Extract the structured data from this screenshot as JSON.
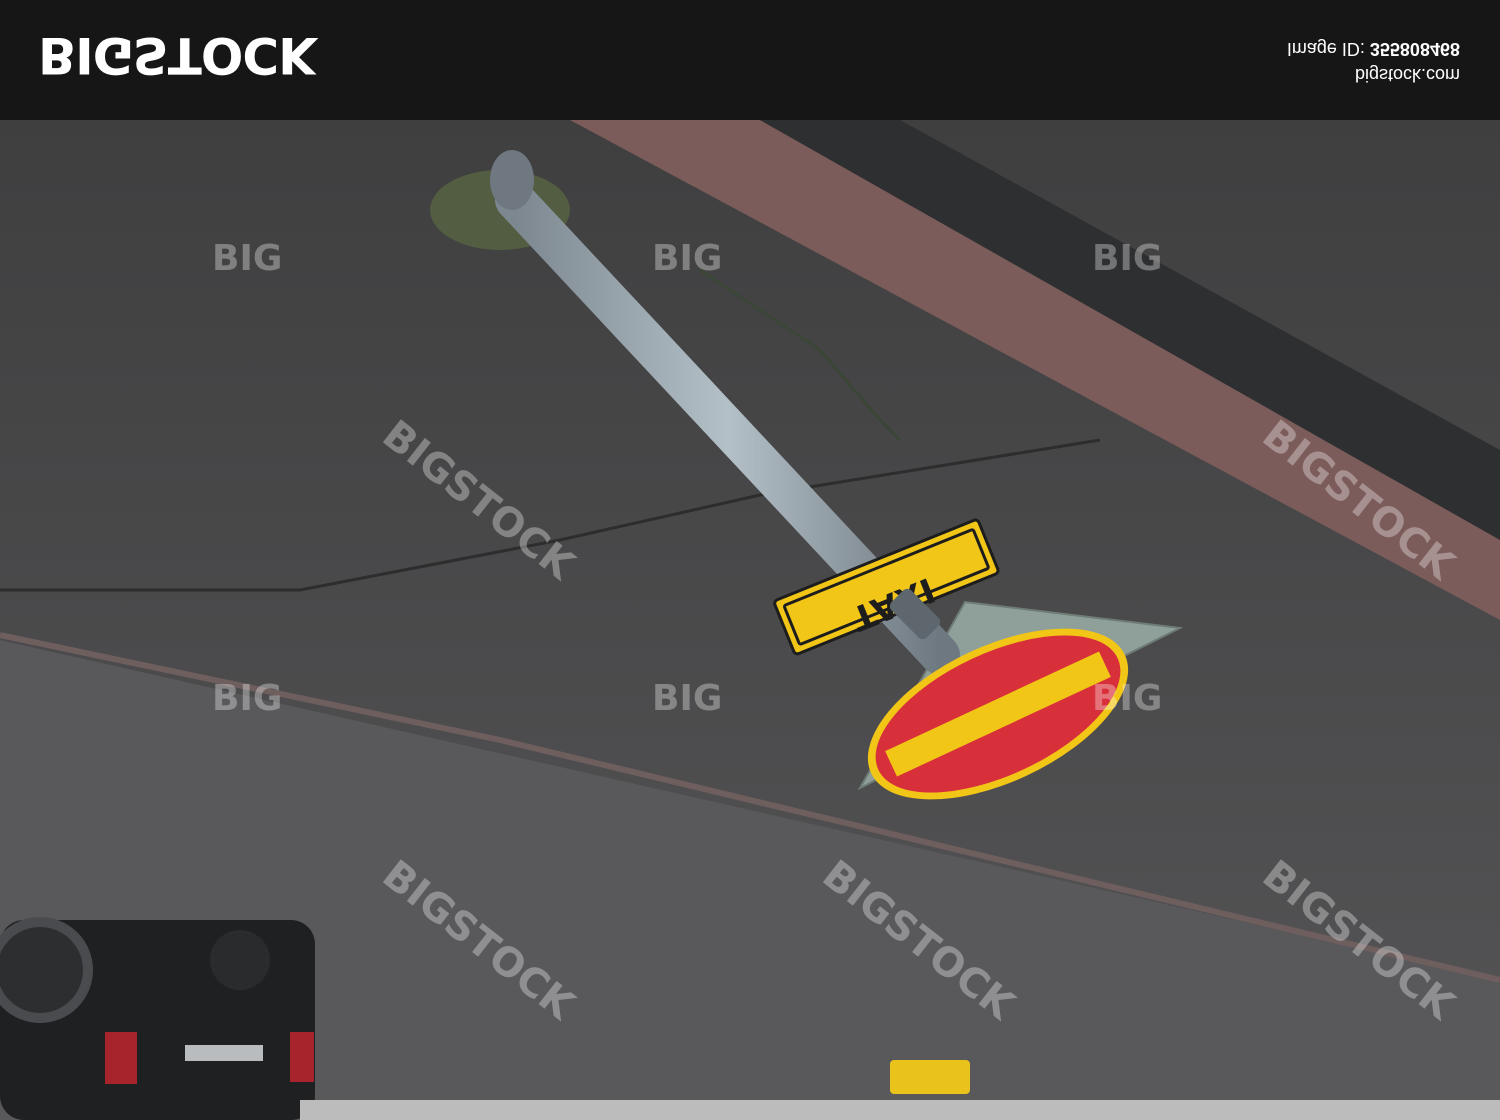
{
  "header": {
    "logo_text": "BIGSTOCK",
    "site": "bigstock.com",
    "image_id_label": "Image ID:",
    "image_id_value": "355808468"
  },
  "photo": {
    "sign_text": "TAXI",
    "watermark_text": "BIGSTOCK",
    "watermark_short": "BIG",
    "colors": {
      "asphalt": "#4a4a4c",
      "curb": "#7a5a58",
      "pole": "#9aa6ad",
      "sign_red": "#d8303a",
      "sign_yellow": "#f2c617"
    }
  }
}
